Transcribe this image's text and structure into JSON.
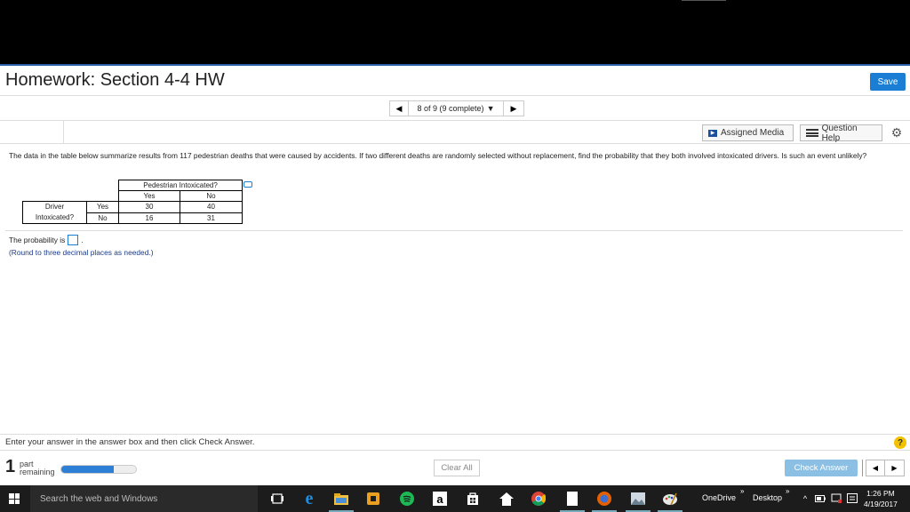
{
  "header": {
    "title": "Homework: Section 4-4 HW",
    "save_label": "Save"
  },
  "nav": {
    "status": "8 of 9 (9 complete)",
    "prev": "◀",
    "next": "▶",
    "dropdown": "▼"
  },
  "toolbar": {
    "assigned_media": "Assigned Media",
    "question_help": "Question Help",
    "media_icon_text": "▶"
  },
  "question": {
    "text": "The data in the table below summarize results from 117 pedestrian deaths that were caused by accidents. If two different deaths are randomly selected without replacement, find the probability that they both involved intoxicated drivers. Is such an event unlikely?",
    "table": {
      "col_group": "Pedestrian Intoxicated?",
      "col_yes": "Yes",
      "col_no": "No",
      "row_group_line1": "Driver",
      "row_group_line2": "Intoxicated?",
      "row_yes": "Yes",
      "row_no": "No",
      "yes_yes": "30",
      "yes_no": "40",
      "no_yes": "16",
      "no_no": "31"
    },
    "answer_prefix": "The probability is",
    "answer_suffix": ".",
    "round_note": "(Round to three decimal places as needed.)"
  },
  "footer": {
    "instruction": "Enter your answer in the answer box and then click Check Answer.",
    "help": "?",
    "parts_num": "1",
    "parts_label1": "part",
    "parts_label2": "remaining",
    "progress": 0.7,
    "clear_all": "Clear All",
    "check_answer": "Check Answer",
    "prev": "◀",
    "next": "▶"
  },
  "taskbar": {
    "search_placeholder": "Search the web and Windows",
    "onedrive": "OneDrive",
    "desktop": "Desktop",
    "chevron": "»",
    "time": "1:26 PM",
    "date": "4/19/2017",
    "amazon_glyph": "a"
  },
  "colors": {
    "accent": "#1a7fd4",
    "save_bg": "#1a7fd4",
    "progress_fill": "#2d7fd6",
    "check_answer_bg": "#8bbfe3",
    "top_border": "#2a5fa8"
  }
}
